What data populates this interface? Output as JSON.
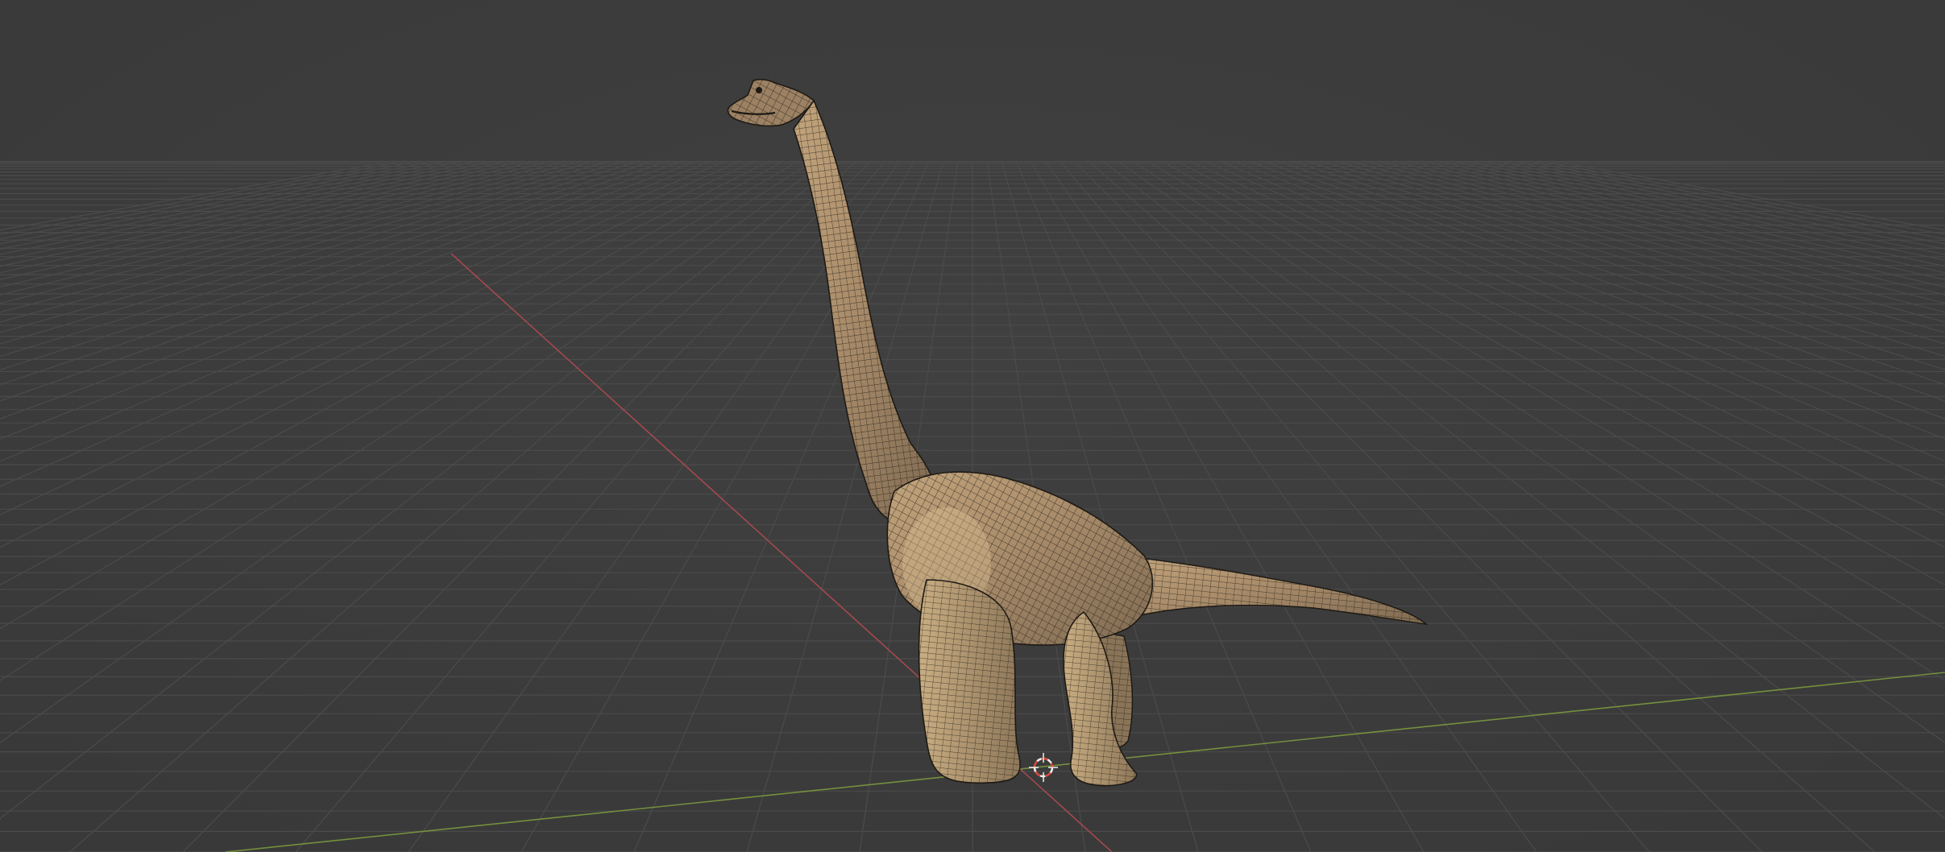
{
  "viewport": {
    "editor": "3D Viewport",
    "shading": "solid",
    "overlay": "wireframe",
    "object": "brachiosaurus-mesh",
    "grid_floor": true,
    "axes": [
      "x",
      "y"
    ]
  },
  "colors": {
    "background": "#3d3d3d",
    "grid": "#4b4b4b",
    "x_axis": "#b04a52",
    "y_axis": "#7a9a3e",
    "mesh_fill": "#a5896a",
    "mesh_wire": "#1e1a14",
    "cursor_red": "#d94a3a",
    "cursor_white": "#f0f0f0"
  },
  "icons": {
    "cursor": "3d-cursor-icon"
  }
}
